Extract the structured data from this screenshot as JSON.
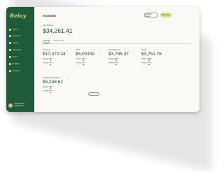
{
  "app": {
    "logo": "Relay"
  },
  "sidebar": {
    "items": [
      {
        "label": "Home"
      },
      {
        "label": "Accounts"
      },
      {
        "label": "Cards"
      },
      {
        "label": "Payments"
      },
      {
        "label": "Taxes"
      },
      {
        "label": "Settings"
      },
      {
        "label": "Support"
      }
    ],
    "user": {
      "name": "Jennifer Brown",
      "email": "jen@relay.com"
    }
  },
  "header": {
    "title": "Accounts",
    "transfer_label": "Transfer money",
    "add_label": "Add money"
  },
  "net_worth": {
    "label": "Total Balance",
    "value": "$34,261.41"
  },
  "tabs": [
    {
      "label": "Accounts"
    },
    {
      "label": "Relay Cards"
    }
  ],
  "accounts": [
    {
      "name": "Accounts",
      "balance": "$10,372.34",
      "acct_label": "Account number",
      "acct_num": "••••4563",
      "routing_label": "Routing number",
      "routing_num": "••••4578"
    },
    {
      "name": "Profit",
      "balance": "$5,00332",
      "acct_label": "Account number",
      "acct_num": "••••1924",
      "routing_label": "Routing number",
      "routing_num": "••••4578"
    },
    {
      "name": "Operating Ops",
      "balance": "$3,785.37",
      "acct_label": "Account number",
      "acct_num": "••••3982",
      "routing_label": "Routing number",
      "routing_num": "••••4578"
    },
    {
      "name": "Taxes",
      "balance": "$3,751.76",
      "acct_label": "Account number",
      "acct_num": "••••5510",
      "routing_label": "Routing number",
      "routing_num": "••••4578"
    },
    {
      "name": "Operating Expenses",
      "balance": "$5,248.62",
      "acct_label": "Account number",
      "acct_num": "••••6687",
      "routing_label": "Routing number",
      "routing_num": "••••4578"
    }
  ],
  "add_account_label": "+ Add account",
  "colors": {
    "sidebar": "#1f5a3b",
    "accent": "#cfe58a",
    "balance": "#1f4a33"
  },
  "icons": {
    "nav": "nav-item-icon",
    "more": "more-dots-icon",
    "copy": "copy-icon"
  }
}
